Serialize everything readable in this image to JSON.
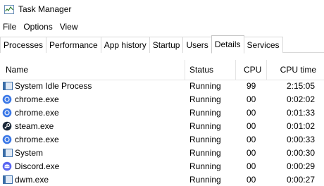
{
  "window": {
    "title": "Task Manager"
  },
  "menu": [
    "File",
    "Options",
    "View"
  ],
  "tabs": [
    {
      "label": "Processes"
    },
    {
      "label": "Performance"
    },
    {
      "label": "App history"
    },
    {
      "label": "Startup"
    },
    {
      "label": "Users"
    },
    {
      "label": "Details",
      "active": true
    },
    {
      "label": "Services"
    }
  ],
  "columns": {
    "name": "Name",
    "status": "Status",
    "cpu": "CPU",
    "cpu_time": "CPU time"
  },
  "processes": [
    {
      "name": "System Idle Process",
      "icon": "system-process-icon",
      "status": "Running",
      "cpu": "99",
      "cpu_time": "2:15:05"
    },
    {
      "name": "chrome.exe",
      "icon": "chrome-icon",
      "status": "Running",
      "cpu": "00",
      "cpu_time": "0:02:02"
    },
    {
      "name": "chrome.exe",
      "icon": "chrome-icon",
      "status": "Running",
      "cpu": "00",
      "cpu_time": "0:01:33"
    },
    {
      "name": "steam.exe",
      "icon": "steam-icon",
      "status": "Running",
      "cpu": "00",
      "cpu_time": "0:01:02"
    },
    {
      "name": "chrome.exe",
      "icon": "chrome-icon",
      "status": "Running",
      "cpu": "00",
      "cpu_time": "0:00:33"
    },
    {
      "name": "System",
      "icon": "system-process-icon",
      "status": "Running",
      "cpu": "00",
      "cpu_time": "0:00:30"
    },
    {
      "name": "Discord.exe",
      "icon": "discord-icon",
      "status": "Running",
      "cpu": "00",
      "cpu_time": "0:00:29"
    },
    {
      "name": "dwm.exe",
      "icon": "system-process-icon",
      "status": "Running",
      "cpu": "00",
      "cpu_time": "0:00:27"
    }
  ],
  "colors": {
    "chrome": "#3b78e7",
    "steam": "#1b2838",
    "discord": "#5865f2",
    "system": "#3b6ea8"
  }
}
